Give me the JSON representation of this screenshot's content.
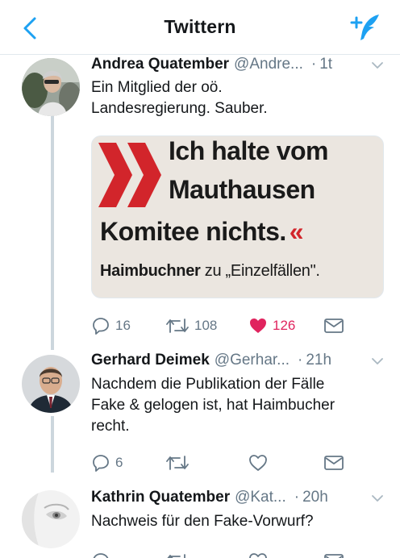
{
  "nav": {
    "title": "Twittern",
    "back_icon": "chevron-left-icon",
    "compose_icon": "compose-tweet-icon",
    "accent_color": "#1da1f2"
  },
  "tweets": [
    {
      "name": "Andrea Quatember",
      "handle": "@Andre...",
      "dot": "·",
      "time": "1t",
      "lines": [
        "Ein Mitglied der oö.",
        "Landesregierung. Sauber."
      ],
      "media": {
        "line1": "Ich halte vom",
        "line2": "Mauthausen",
        "line3": "Komitee nichts.",
        "line3_mark": "«",
        "line4_bold": "Haimbuchner",
        "line4_rest": " zu „Einzelfällen\"."
      },
      "replies": "16",
      "retweets": "108",
      "likes": "126",
      "liked": true
    },
    {
      "name": "Gerhard Deimek",
      "handle": "@Gerhar...",
      "dot": "·",
      "time": "21h",
      "lines": [
        "Nachdem die Publikation der Fälle",
        "Fake & gelogen ist, hat Haimbucher",
        "recht."
      ],
      "replies": "6",
      "retweets": "",
      "likes": "",
      "liked": false
    },
    {
      "name": "Kathrin Quatember",
      "handle": "@Kat...",
      "dot": "·",
      "time": "20h",
      "lines": [
        "Nachweis für den Fake-Vorwurf?"
      ]
    }
  ],
  "colors": {
    "text": "#14171a",
    "secondary": "#657786",
    "like": "#e0245e",
    "media_red": "#d2252b"
  }
}
